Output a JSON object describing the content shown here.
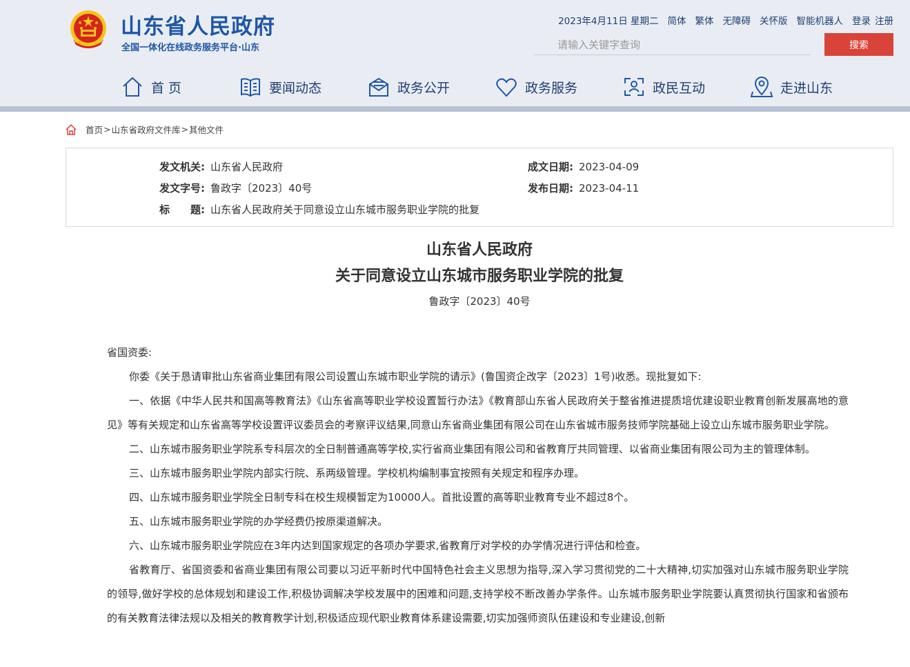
{
  "header": {
    "title": "山东省人民政府",
    "subtitle": "全国一体化在线政务服务平台·山东",
    "date": "2023年4月11日 星期二",
    "links": [
      "简体",
      "繁体",
      "无障碍",
      "关怀版",
      "智能机器人",
      "登录",
      "注册"
    ],
    "search_placeholder": "请输入关键字查询",
    "search_button": "搜索"
  },
  "nav": [
    "首 页",
    "要闻动态",
    "政务公开",
    "政务服务",
    "政民互动",
    "走进山东"
  ],
  "breadcrumb": [
    "首页",
    "山东省政府文件库",
    "其他文件"
  ],
  "info": {
    "issuer_label": "发文机关:",
    "issuer": "山东省人民政府",
    "number_label": "发文字号:",
    "number": "鲁政字〔2023〕40号",
    "title_label": "标　　题:",
    "title": "山东省人民政府关于同意设立山东城市服务职业学院的批复",
    "created_label": "成文日期:",
    "created": "2023-04-09",
    "published_label": "发布日期:",
    "published": "2023-04-11"
  },
  "document": {
    "title_line1": "山东省人民政府",
    "title_line2": "关于同意设立山东城市服务职业学院的批复",
    "doc_number": "鲁政字〔2023〕40号",
    "salutation": "省国资委:",
    "paragraphs": [
      "你委《关于恳请审批山东省商业集团有限公司设置山东城市职业学院的请示》(鲁国资企改字〔2023〕1号)收悉。现批复如下:",
      "一、依据《中华人民共和国高等教育法》《山东省高等职业学校设置暂行办法》《教育部山东省人民政府关于整省推进提质培优建设职业教育创新发展高地的意见》等有关规定和山东省高等学校设置评议委员会的考察评议结果,同意山东省商业集团有限公司在山东省城市服务技师学院基础上设立山东城市服务职业学院。",
      "二、山东城市服务职业学院系专科层次的全日制普通高等学校,实行省商业集团有限公司和省教育厅共同管理、以省商业集团有限公司为主的管理体制。",
      "三、山东城市服务职业学院内部实行院、系两级管理。学校机构编制事宜按照有关规定和程序办理。",
      "四、山东城市服务职业学院全日制专科在校生规模暂定为10000人。首批设置的高等职业教育专业不超过8个。",
      "五、山东城市服务职业学院的办学经费仍按原渠道解决。",
      "六、山东城市服务职业学院应在3年内达到国家规定的各项办学要求,省教育厅对学校的办学情况进行评估和检查。",
      "省教育厅、省国资委和省商业集团有限公司要以习近平新时代中国特色社会主义思想为指导,深入学习贯彻党的二十大精神,切实加强对山东城市服务职业学院的领导,做好学校的总体规划和建设工作,积极协调解决学校发展中的困难和问题,支持学校不断改善办学条件。山东城市服务职业学院要认真贯彻执行国家和省颁布的有关教育法律法规以及相关的教育教学计划,积极适应现代职业教育体系建设需要,切实加强师资队伍建设和专业建设,创新"
    ]
  },
  "colors": {
    "brand_blue": "#1f56a6",
    "nav_text": "#1f3f73",
    "search_red": "#d8433a",
    "header_bg": "#e9edf3"
  }
}
